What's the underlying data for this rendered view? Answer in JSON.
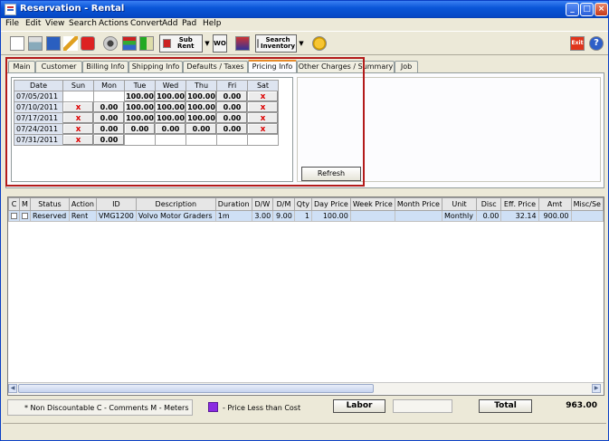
{
  "window": {
    "title": "Reservation - Rental",
    "controls": [
      "_",
      "□",
      "×"
    ]
  },
  "menu": [
    "File",
    "Edit",
    "View",
    "Search",
    "Actions",
    "Convert",
    "Add",
    "Pad",
    "Help"
  ],
  "toolbar": {
    "sub_rent_label": "Sub Rent",
    "wo_label": "WO",
    "search_inventory_label_1": "Search",
    "search_inventory_label_2": "Inventory",
    "exit_label": "Exit",
    "help_label": "?"
  },
  "tabs": [
    "Main",
    "Customer",
    "Billing Info",
    "Shipping Info",
    "Defaults / Taxes",
    "Pricing Info",
    "Other Charges / Summary",
    "Job"
  ],
  "active_tab": "Pricing Info",
  "pricing": {
    "headers": [
      "Date",
      "Sun",
      "Mon",
      "Tue",
      "Wed",
      "Thu",
      "Fri",
      "Sat"
    ],
    "rows": [
      [
        "07/05/2011",
        "",
        "",
        "100.00",
        "100.00",
        "100.00",
        "0.00",
        "x"
      ],
      [
        "07/10/2011",
        "x",
        "0.00",
        "100.00",
        "100.00",
        "100.00",
        "0.00",
        "x"
      ],
      [
        "07/17/2011",
        "x",
        "0.00",
        "100.00",
        "100.00",
        "100.00",
        "0.00",
        "x"
      ],
      [
        "07/24/2011",
        "x",
        "0.00",
        "0.00",
        "0.00",
        "0.00",
        "0.00",
        "x"
      ],
      [
        "07/31/2011",
        "x",
        "0.00",
        "",
        "",
        "",
        "",
        ""
      ]
    ],
    "refresh_label": "Refresh"
  },
  "lines": {
    "headers": [
      "C",
      "M",
      "Status",
      "Action",
      "ID",
      "Description",
      "Duration",
      "D/W",
      "D/M",
      "Qty",
      "Day Price",
      "Week Price",
      "Month Price",
      "Unit",
      "Disc",
      "Eff. Price",
      "Amt",
      "Misc/Se"
    ],
    "rows": [
      [
        "",
        "",
        "Reserved",
        "Rent",
        "VMG1200",
        "Volvo Motor Graders",
        "1m",
        "3.00",
        "9.00",
        "1",
        "100.00",
        "",
        "",
        "Monthly",
        "0.00",
        "32.14",
        "900.00",
        ""
      ]
    ]
  },
  "footer": {
    "legend_text": "* Non Discountable   C - Comments    M - Meters",
    "swatch_color": "#8a2be2",
    "swatch_label": "- Price Less than Cost",
    "labor_label": "Labor",
    "total_label": "Total",
    "total_value": "963.00"
  }
}
